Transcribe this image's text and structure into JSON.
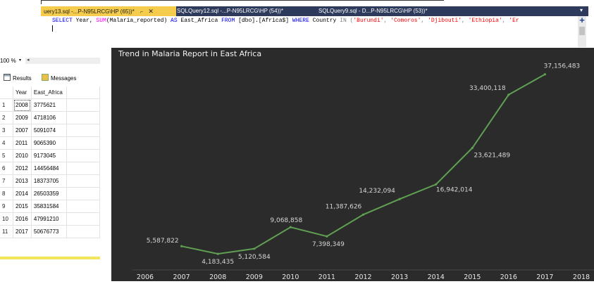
{
  "editor": {
    "tabs": [
      {
        "label": "uery13.sql -...P-N95LRCG\\HP (65))*",
        "pin": "⌐",
        "close": "✕",
        "active": true
      },
      {
        "label": "SQLQuery12.sql -...P-N95LRCG\\HP (54))*",
        "active": false
      },
      {
        "label": "SQLQuery9.sql - D...P-N95LRCG\\HP (53))*",
        "active": false
      }
    ],
    "overflow_icon": "▾",
    "sql": {
      "select": "SELECT",
      "p1": " Year, ",
      "sum": "SUM",
      "p2": "(Malaria_reported) ",
      "as": "AS",
      "p3": " East_Africa ",
      "from": "FROM",
      "p4": " [dbo].[Africa$] ",
      "where": "WHERE",
      "p5": " Country ",
      "in": "IN",
      "p6": " (",
      "s1": "'Burundi'",
      "c1": ", ",
      "s2": "'Comoros'",
      "c2": ", ",
      "s3": "'Djibouti'",
      "c3": ", ",
      "s4": "'Ethiopia'",
      "c4": ", ",
      "s5": "'Er"
    },
    "split_icon": "+"
  },
  "results": {
    "zoom": "100 %",
    "zoom_arrow": "▾",
    "scroll_left": "◂",
    "tabs": {
      "results": "Results",
      "messages": "Messages"
    },
    "columns": [
      "Year",
      "East_Africa"
    ],
    "rows": [
      {
        "n": "1",
        "year": "2008",
        "value": "3775621"
      },
      {
        "n": "2",
        "year": "2009",
        "value": "4718106"
      },
      {
        "n": "3",
        "year": "2007",
        "value": "5091074"
      },
      {
        "n": "4",
        "year": "2011",
        "value": "9065390"
      },
      {
        "n": "5",
        "year": "2010",
        "value": "9173045"
      },
      {
        "n": "6",
        "year": "2012",
        "value": "14456484"
      },
      {
        "n": "7",
        "year": "2013",
        "value": "18373705"
      },
      {
        "n": "8",
        "year": "2014",
        "value": "26503359"
      },
      {
        "n": "9",
        "year": "2015",
        "value": "35831584"
      },
      {
        "n": "10",
        "year": "2016",
        "value": "47991210"
      },
      {
        "n": "11",
        "year": "2017",
        "value": "50676773"
      }
    ],
    "status_color": "#f4e55a"
  },
  "chart_data": {
    "type": "line",
    "title": "Trend in Malaria Report in East Africa",
    "x": [
      2007,
      2008,
      2009,
      2010,
      2011,
      2012,
      2013,
      2014,
      2015,
      2016,
      2017
    ],
    "x_ticks": [
      "2006",
      "2007",
      "2008",
      "2009",
      "2010",
      "2011",
      "2012",
      "2013",
      "2014",
      "2015",
      "2016",
      "2017",
      "2018"
    ],
    "values": [
      5587822,
      4183435,
      5120584,
      9068858,
      7398349,
      11387626,
      14232094,
      16942014,
      23621489,
      33400118,
      37156483
    ],
    "labels": [
      "5,587,822",
      "4,183,435",
      "5,120,584",
      "9,068,858",
      "7,398,349",
      "11,387,626",
      "14,232,094",
      "16,942,014",
      "23,621,489",
      "33,400,118",
      "37,156,483"
    ],
    "xlim": [
      2006,
      2018
    ],
    "grid": false,
    "line_color": "#5fa052",
    "background": "#2b2b2b"
  }
}
